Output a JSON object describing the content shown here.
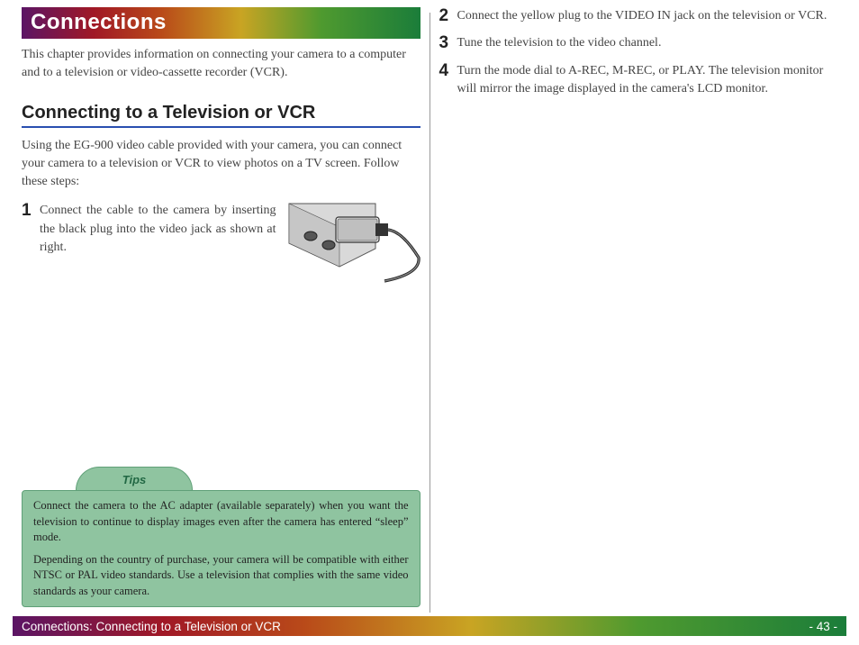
{
  "header": {
    "title": "Connections"
  },
  "intro": "This chapter provides information on connecting your camera to a computer and to a television or video-cassette recorder (VCR).",
  "section": {
    "heading": "Connecting to a Television or VCR",
    "intro": "Using the EG-900 video cable provided with your camera, you can connect your camera to a television or VCR to view photos on a TV screen.  Follow these steps:"
  },
  "steps": [
    {
      "num": "1",
      "text": "Connect the cable to the camera by inserting the black plug into the video jack as shown at right."
    },
    {
      "num": "2",
      "text": "Connect the yellow plug to the VIDEO IN jack on the television or VCR."
    },
    {
      "num": "3",
      "text": "Tune the television to the video channel."
    },
    {
      "num": "4",
      "text": "Turn the mode dial to A-REC, M-REC, or PLAY.  The television monitor will mirror the image displayed in the camera's LCD monitor."
    }
  ],
  "tips": {
    "label": "Tips",
    "paragraphs": [
      "Connect the camera to the AC adapter (available separately) when you want the television to continue to display images even after the camera has entered “sleep” mode.",
      "Depending on the country of purchase, your camera will be compatible with either NTSC or PAL video standards.  Use a television that complies with the same video standards as your camera."
    ]
  },
  "footer": {
    "breadcrumb": "Connections: Connecting to a Television or VCR",
    "page": "- 43 -"
  }
}
